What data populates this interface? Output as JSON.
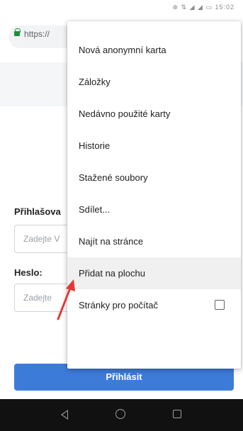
{
  "status_bar": {
    "icons": "⊕ ⇅ ◢ ◢ ▭ 15:02"
  },
  "browser": {
    "url": "https://"
  },
  "menu": {
    "items": [
      {
        "label": "Nová anonymní karta"
      },
      {
        "label": "Záložky"
      },
      {
        "label": "Nedávno použité karty"
      },
      {
        "label": "Historie"
      },
      {
        "label": "Stažené soubory"
      },
      {
        "label": "Sdílet..."
      },
      {
        "label": "Najít na stránce"
      },
      {
        "label": "Přidat na plochu",
        "highlighted": true
      },
      {
        "label": "Stránky pro počítač",
        "checkbox": false
      }
    ]
  },
  "login_form": {
    "login_label": "Přihlašova",
    "login_placeholder": "Zadejte V",
    "password_label": "Heslo:",
    "password_placeholder": "Zadejte",
    "submit_label": "Přihlásit"
  },
  "colors": {
    "accent": "#3d7bd9",
    "arrow": "#e53935",
    "lock": "#1e8e3e"
  }
}
